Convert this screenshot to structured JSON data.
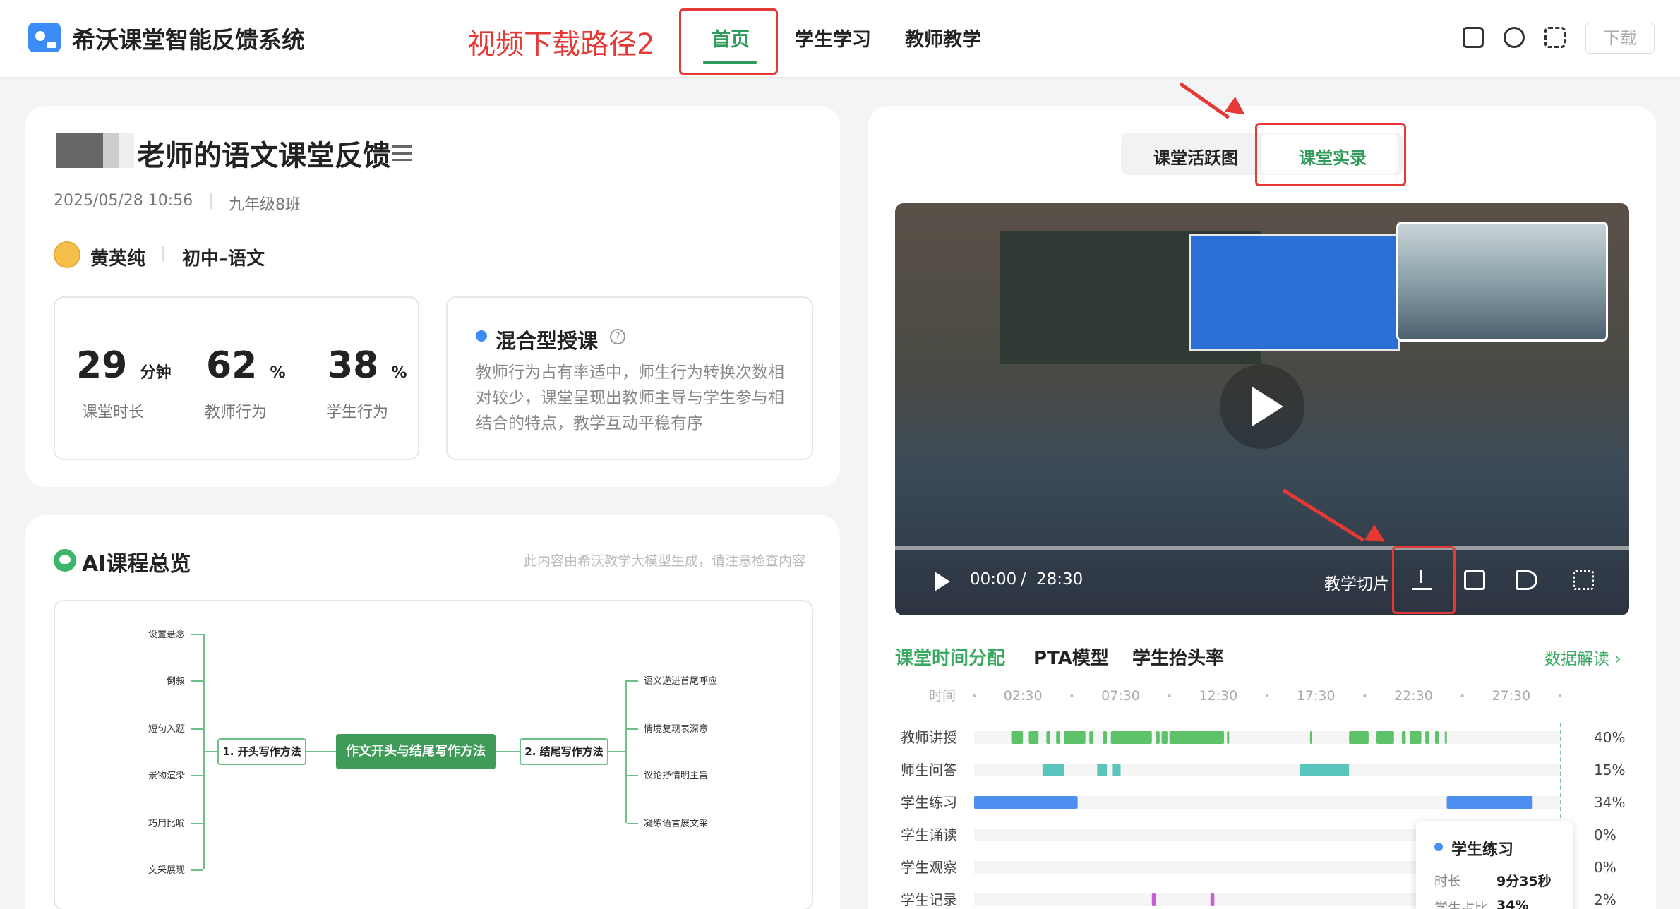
{
  "header": {
    "app_title": "希沃课堂智能反馈系统",
    "annotation": "视频下载路径2",
    "nav": [
      "首页",
      "学生学习",
      "教师教学"
    ],
    "download_label": "下载",
    "icons": [
      "feedback-icon",
      "a-badge-icon",
      "fullscreen-icon"
    ]
  },
  "lesson": {
    "title": "老师的语文课堂反馈",
    "datetime": "2025/05/28 10:56",
    "class_name": "九年级8班",
    "teacher": "黄英纯",
    "subject": "初中–语文",
    "stats": [
      {
        "value": "29",
        "unit": "分钟",
        "label": "课堂时长"
      },
      {
        "value": "62",
        "unit": "%",
        "label": "教师行为"
      },
      {
        "value": "38",
        "unit": "%",
        "label": "学生行为"
      }
    ],
    "mode_title": "混合型授课",
    "mode_desc": "教师行为占有率适中，师生行为转换次数相对较少，课堂呈现出教师主导与学生参与相结合的特点，教学互动平稳有序"
  },
  "ai": {
    "title": "AI课程总览",
    "note": "此内容由希沃教学大模型生成，请注意检查内容",
    "mindmap": {
      "center": "作文开头与结尾写作方法",
      "left_branch": "1. 开头写作方法",
      "left_leaves": [
        "设置悬念",
        "倒叙",
        "短句入题",
        "景物渲染",
        "巧用比喻",
        "文采展现"
      ],
      "right_branch": "2. 结尾写作方法",
      "right_leaves": [
        "语义递进首尾呼应",
        "情境复现表深意",
        "议论抒情明主旨",
        "凝练语言展文采"
      ]
    }
  },
  "video_panel": {
    "tabs": [
      "课堂活跃图",
      "课堂实录"
    ],
    "time_current": "00:00",
    "time_sep": "/",
    "time_total": "28:30",
    "clip_label": "教学切片",
    "icons": [
      "play-icon",
      "download-icon",
      "subtitle-icon",
      "volume-icon",
      "expand-icon"
    ]
  },
  "timeline": {
    "tabs": [
      "课堂时间分配",
      "PTA模型",
      "学生抬头率"
    ],
    "data_link": "数据解读 ›",
    "axis_label": "时间",
    "ticks": [
      "02:30",
      "07:30",
      "12:30",
      "17:30",
      "22:30",
      "27:30"
    ],
    "rows": [
      {
        "label": "教师讲授",
        "pct": "40%",
        "color": "#5ec26a",
        "segments": [
          [
            1.9,
            2.5
          ],
          [
            2.8,
            3.3
          ],
          [
            3.7,
            3.9
          ],
          [
            4.2,
            4.4
          ],
          [
            4.6,
            5.7
          ],
          [
            5.9,
            6.1
          ],
          [
            6.6,
            6.8
          ],
          [
            7.0,
            9.1
          ],
          [
            9.3,
            9.5
          ],
          [
            9.6,
            9.9
          ],
          [
            10.0,
            12.8
          ],
          [
            12.95,
            13.05
          ],
          [
            17.2,
            17.3
          ],
          [
            19.2,
            20.2
          ],
          [
            20.6,
            21.5
          ],
          [
            21.9,
            22.1
          ],
          [
            22.3,
            22.9
          ],
          [
            23.1,
            23.3
          ],
          [
            23.6,
            23.8
          ],
          [
            24.1,
            24.2
          ]
        ]
      },
      {
        "label": "师生问答",
        "pct": "15%",
        "color": "#5ac5bd",
        "segments": [
          [
            3.5,
            4.6
          ],
          [
            6.3,
            6.8
          ],
          [
            7.1,
            7.5
          ],
          [
            16.7,
            19.2
          ]
        ]
      },
      {
        "label": "学生练习",
        "pct": "34%",
        "color": "#4c8ff0",
        "segments": [
          [
            0.0,
            5.3
          ],
          [
            24.2,
            28.6
          ]
        ]
      },
      {
        "label": "学生诵读",
        "pct": "0%",
        "color": "#4c8ff0",
        "segments": []
      },
      {
        "label": "学生观察",
        "pct": "0%",
        "color": "#4c8ff0",
        "segments": []
      },
      {
        "label": "学生记录",
        "pct": "2%",
        "color": "#c45fd6",
        "segments": [
          [
            9.1,
            9.3
          ],
          [
            12.1,
            12.3
          ]
        ]
      }
    ],
    "tooltip": {
      "title": "学生练习",
      "duration_label": "时长",
      "duration_value": "9分35秒",
      "share_label": "学生占比",
      "share_value": "34%"
    }
  },
  "chart_data": {
    "type": "bar",
    "x_unit": "minutes",
    "xlim": [
      0,
      30
    ],
    "categories": [
      "教师讲授",
      "师生问答",
      "学生练习",
      "学生诵读",
      "学生观察",
      "学生记录"
    ],
    "values": [
      40,
      15,
      34,
      0,
      0,
      2
    ]
  },
  "colors": {
    "accent": "#2e9c5a",
    "annotation": "#e53935"
  }
}
